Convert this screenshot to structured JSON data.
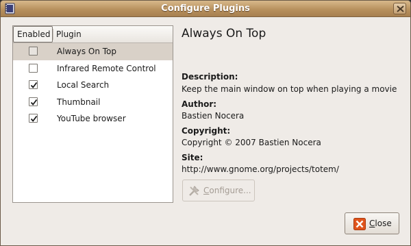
{
  "window": {
    "title": "Configure Plugins",
    "close_icon": "close-icon"
  },
  "list": {
    "header_enabled": "Enabled",
    "header_plugin": "Plugin",
    "plugins": [
      {
        "name": "Always On Top",
        "enabled": false,
        "selected": true
      },
      {
        "name": "Infrared Remote Control",
        "enabled": false,
        "selected": false
      },
      {
        "name": "Local Search",
        "enabled": true,
        "selected": false
      },
      {
        "name": "Thumbnail",
        "enabled": true,
        "selected": false
      },
      {
        "name": "YouTube browser",
        "enabled": true,
        "selected": false
      }
    ]
  },
  "details": {
    "title": "Always On Top",
    "description_label": "Description:",
    "description": "Keep the main window on top when playing a movie",
    "author_label": "Author:",
    "author": "Bastien Nocera",
    "copyright_label": "Copyright:",
    "copyright": "Copyright © 2007 Bastien Nocera",
    "site_label": "Site:",
    "site": "http://www.gnome.org/projects/totem/"
  },
  "buttons": {
    "configure": "Configure...",
    "configure_enabled": false,
    "close": "Close"
  },
  "colors": {
    "titlebar": "#b8915e",
    "selection": "#d9d1c8",
    "close_icon": "#e0541c"
  }
}
